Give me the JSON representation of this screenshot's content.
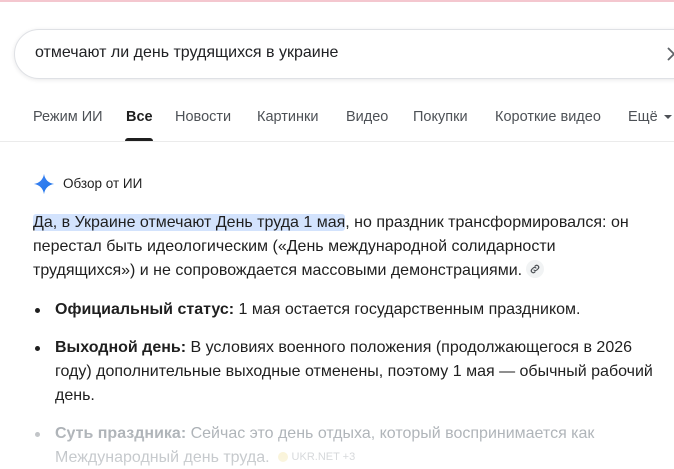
{
  "search": {
    "query": "отмечают ли день трудящихся в украине"
  },
  "tabs": [
    {
      "label": "Режим ИИ"
    },
    {
      "label": "Все"
    },
    {
      "label": "Новости"
    },
    {
      "label": "Картинки"
    },
    {
      "label": "Видео"
    },
    {
      "label": "Покупки"
    },
    {
      "label": "Короткие видео"
    },
    {
      "label": "Ещё"
    }
  ],
  "ai_overview": {
    "title": "Обзор от ИИ",
    "highlight": "Да, в Украине отмечают День труда 1 мая",
    "intro_rest": ", но праздник трансформировался: он перестал быть идеологическим («День международной солидарности трудящихся») и не сопровождается массовыми демонстрациями.",
    "bullets": [
      {
        "label": "Официальный статус:",
        "text": " 1 мая остается государственным праздником."
      },
      {
        "label": "Выходной день:",
        "text": " В условиях военного положения (продолжающегося в 2026 году) дополнительные выходные отменены, поэтому 1 мая — обычный рабочий день."
      },
      {
        "label": "Суть праздника:",
        "text": " Сейчас это день отдыха, который воспринимается как Международный день труда."
      }
    ],
    "source_chip": "UKR.NET +3"
  },
  "colors": {
    "highlight_bg": "#d3e3fd",
    "accent_blue": "#4285f4"
  }
}
